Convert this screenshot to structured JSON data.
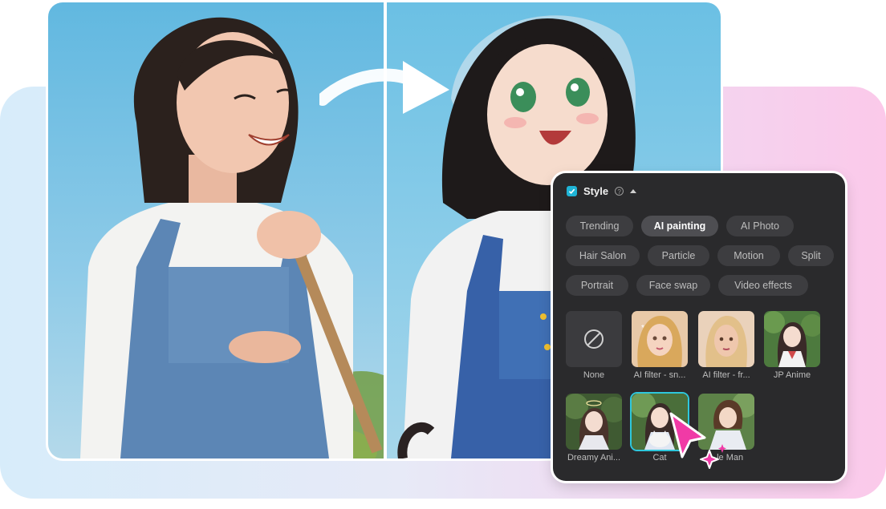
{
  "panel": {
    "title": "Style",
    "chips": [
      {
        "label": "Trending",
        "active": false
      },
      {
        "label": "AI painting",
        "active": true
      },
      {
        "label": "AI Photo",
        "active": false
      },
      {
        "label": "Hair Salon",
        "active": false
      },
      {
        "label": "Particle",
        "active": false
      },
      {
        "label": "Motion",
        "active": false
      },
      {
        "label": "Split",
        "active": false
      },
      {
        "label": "Portrait",
        "active": false
      },
      {
        "label": "Face swap",
        "active": false
      },
      {
        "label": "Video effects",
        "active": false
      }
    ],
    "styles": [
      {
        "label": "None",
        "icon": "none-icon",
        "selected": false
      },
      {
        "label": "AI filter - sn...",
        "selected": false
      },
      {
        "label": "AI filter - fr...",
        "selected": false
      },
      {
        "label": "JP Anime",
        "selected": false
      },
      {
        "label": "Dreamy Ani...",
        "selected": false
      },
      {
        "label": "Cat",
        "selected": true
      },
      {
        "label": "...le Man",
        "selected": false
      }
    ]
  },
  "colors": {
    "accent": "#1fb4d6",
    "cursor": "#f03aa6",
    "panel_bg": "#2a2a2c"
  }
}
